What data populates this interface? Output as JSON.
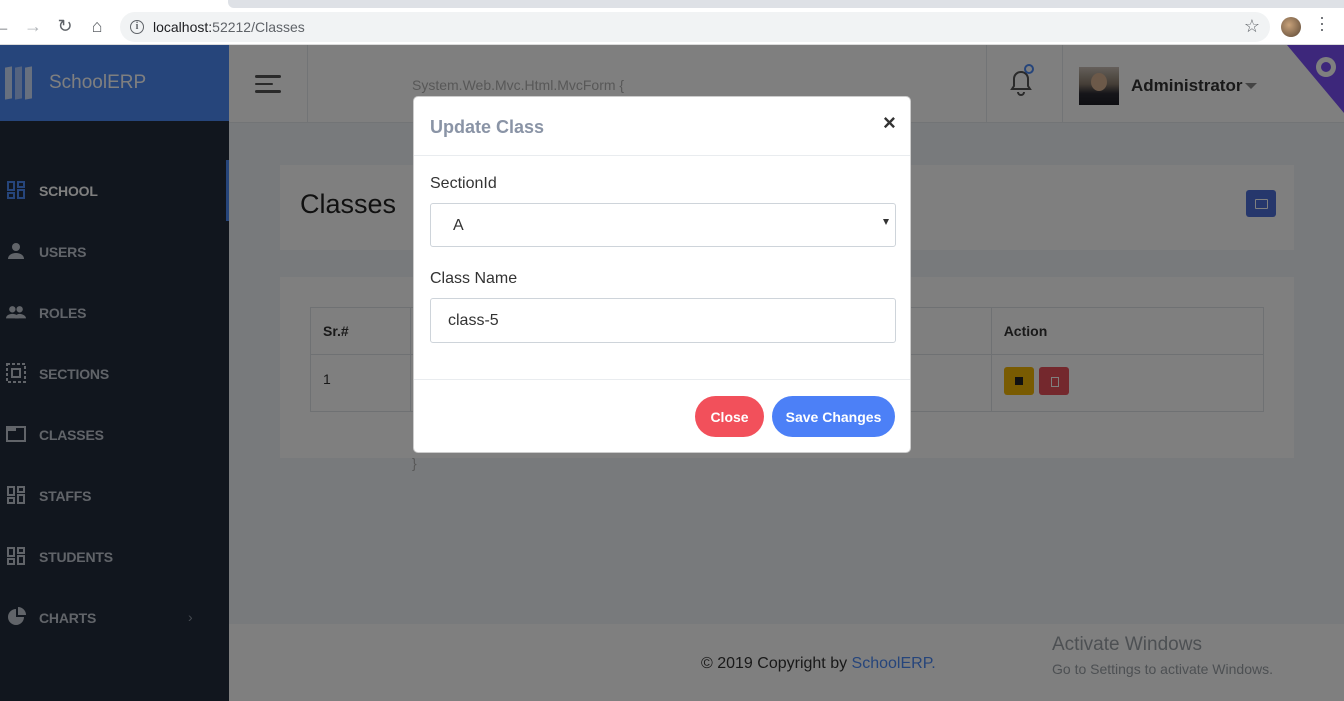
{
  "browser": {
    "url_host": "localhost:",
    "url_path": "52212/Classes"
  },
  "sidebar": {
    "brand": "SchoolERP",
    "items": [
      {
        "label": "SCHOOL",
        "icon": "dashboard-grid-icon",
        "active": true
      },
      {
        "label": "USERS",
        "icon": "person-icon"
      },
      {
        "label": "ROLES",
        "icon": "people-icon"
      },
      {
        "label": "SECTIONS",
        "icon": "dashed-select-icon"
      },
      {
        "label": "CLASSES",
        "icon": "window-icon"
      },
      {
        "label": "STAFFS",
        "icon": "dashboard-grid-icon"
      },
      {
        "label": "STUDENTS",
        "icon": "dashboard-grid-icon"
      },
      {
        "label": "CHARTS",
        "icon": "pie-chart-icon"
      }
    ]
  },
  "topbar": {
    "mvc_text": "System.Web.Mvc.Html.MvcForm {",
    "user_name": "Administrator"
  },
  "page": {
    "title": "Classes",
    "stray_brace": "}"
  },
  "table": {
    "headers": [
      "Sr.#",
      "",
      "Action"
    ],
    "rows": [
      {
        "sr": "1"
      }
    ]
  },
  "footer": {
    "copyright_prefix": "© 2019 Copyright by ",
    "copyright_link": "SchoolERP.",
    "windows_title": "Activate Windows",
    "windows_sub": "Go to Settings to activate Windows."
  },
  "modal": {
    "title": "Update Class",
    "close_symbol": "×",
    "section_label": "SectionId",
    "section_value": "A",
    "class_label": "Class Name",
    "class_value": "class-5",
    "close_button": "Close",
    "save_button": "Save Changes"
  },
  "colors": {
    "brand": "#4c8af7",
    "sidebar_bg": "#222d3c",
    "danger": "#f2505b",
    "warning": "#f2b705"
  }
}
